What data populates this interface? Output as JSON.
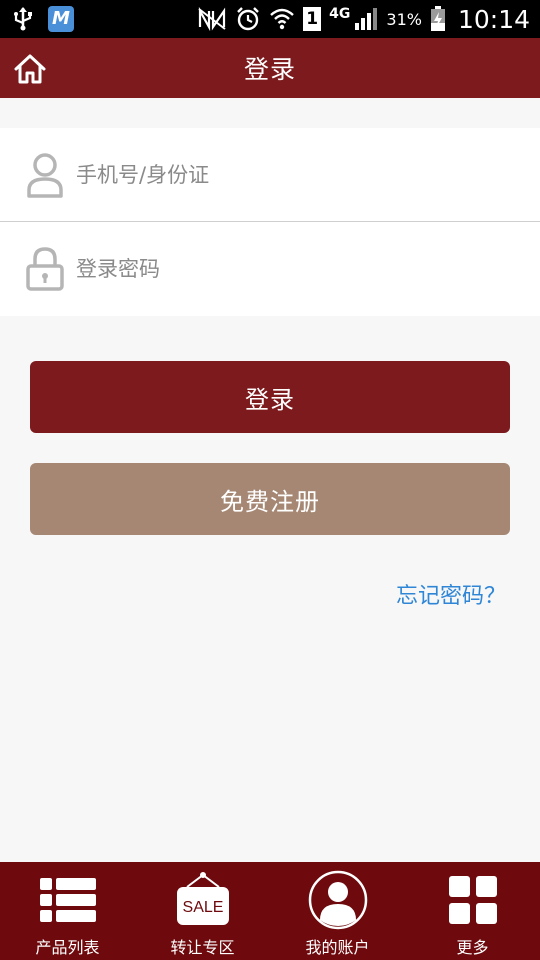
{
  "status_bar": {
    "app_badge": "M",
    "sim_slot": "1",
    "network_type": "4G",
    "battery": "31%",
    "time": "10:14"
  },
  "header": {
    "title": "登录"
  },
  "form": {
    "phone_placeholder": "手机号/身份证",
    "password_placeholder": "登录密码"
  },
  "actions": {
    "login_label": "登录",
    "register_label": "免费注册",
    "forgot_label": "忘记密码？"
  },
  "bottom_nav": {
    "items": [
      {
        "label": "产品列表",
        "icon": "list-icon"
      },
      {
        "label": "转让专区",
        "icon": "sale-sign-icon"
      },
      {
        "label": "我的账户",
        "icon": "account-icon"
      },
      {
        "label": "更多",
        "icon": "grid-icon"
      }
    ],
    "sale_sign_text": "SALE"
  },
  "colors": {
    "brand": "#7c1a1d",
    "register": "#a58773",
    "link": "#2f86d6",
    "nav_bg": "#6e0a0d"
  }
}
